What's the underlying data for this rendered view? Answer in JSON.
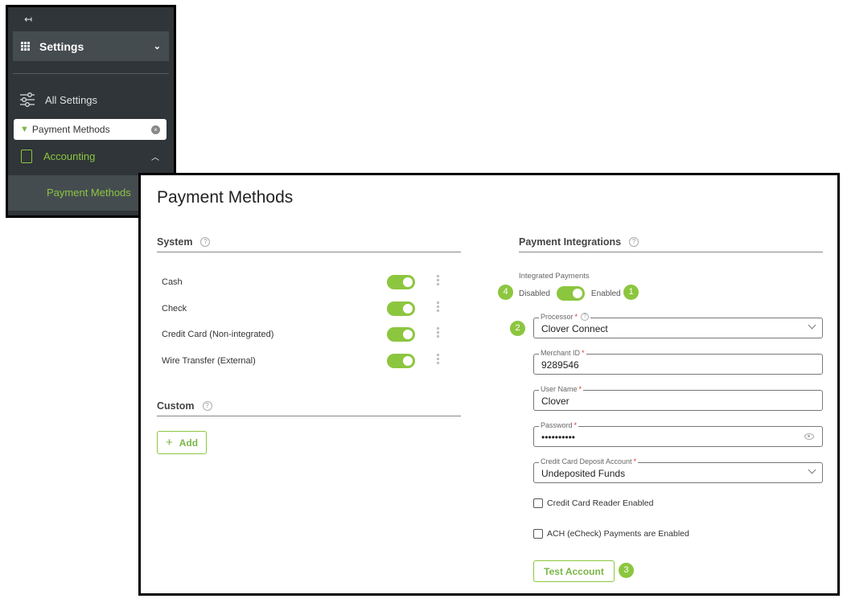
{
  "sidebar": {
    "collapse_icon": "↤",
    "header_label": "Settings",
    "all_settings_label": "All Settings",
    "search_value": "Payment Methods",
    "accounting_label": "Accounting",
    "active_item_label": "Payment Methods"
  },
  "page": {
    "title": "Payment Methods"
  },
  "system": {
    "title": "System",
    "rows": [
      {
        "label": "Cash",
        "enabled": true
      },
      {
        "label": "Check",
        "enabled": true
      },
      {
        "label": "Credit Card (Non-integrated)",
        "enabled": true
      },
      {
        "label": "Wire Transfer (External)",
        "enabled": true
      }
    ]
  },
  "custom": {
    "title": "Custom",
    "add_label": "Add"
  },
  "integrations": {
    "title": "Payment Integrations",
    "integrated_label": "Integrated Payments",
    "disabled_label": "Disabled",
    "enabled_label": "Enabled",
    "processor": {
      "label": "Processor",
      "value": "Clover Connect"
    },
    "merchant_id": {
      "label": "Merchant ID",
      "value": "9289546"
    },
    "user_name": {
      "label": "User Name",
      "value": "Clover"
    },
    "password": {
      "label": "Password",
      "value": "••••••••••"
    },
    "deposit_account": {
      "label": "Credit Card Deposit Account",
      "value": "Undeposited Funds"
    },
    "reader_label": "Credit Card Reader Enabled",
    "ach_label": "ACH (eCheck) Payments are Enabled",
    "test_label": "Test Account"
  },
  "badges": {
    "one": "1",
    "two": "2",
    "three": "3",
    "four": "4"
  },
  "colors": {
    "accent": "#8cc63f",
    "sidebar_bg": "#2f3538"
  }
}
